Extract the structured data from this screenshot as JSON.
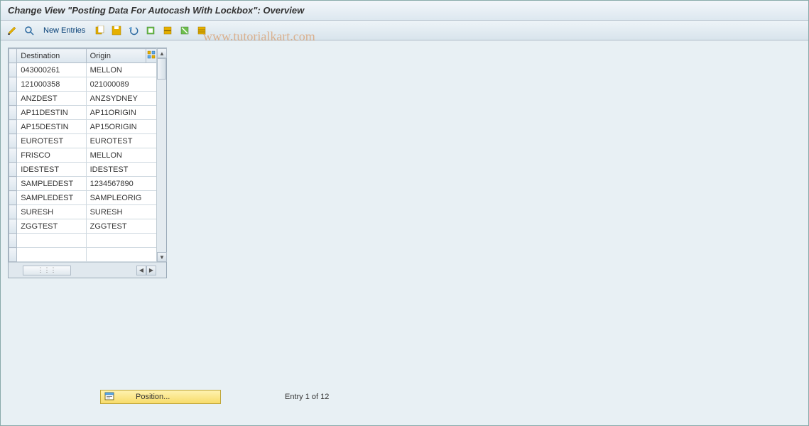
{
  "title": "Change View \"Posting Data For Autocash With Lockbox\": Overview",
  "toolbar": {
    "new_entries": "New Entries"
  },
  "watermark": "www.tutorialkart.com",
  "table": {
    "headers": {
      "destination": "Destination",
      "origin": "Origin"
    },
    "rows": [
      {
        "destination": "043000261",
        "origin": "MELLON"
      },
      {
        "destination": "121000358",
        "origin": "021000089"
      },
      {
        "destination": "ANZDEST",
        "origin": "ANZSYDNEY"
      },
      {
        "destination": "AP11DESTIN",
        "origin": "AP11ORIGIN"
      },
      {
        "destination": "AP15DESTIN",
        "origin": "AP15ORIGIN"
      },
      {
        "destination": "EUROTEST",
        "origin": "EUROTEST"
      },
      {
        "destination": "FRISCO",
        "origin": "MELLON"
      },
      {
        "destination": "IDESTEST",
        "origin": "IDESTEST"
      },
      {
        "destination": "SAMPLEDEST",
        "origin": "1234567890"
      },
      {
        "destination": "SAMPLEDEST",
        "origin": "SAMPLEORIG"
      },
      {
        "destination": "SURESH",
        "origin": "SURESH"
      },
      {
        "destination": "ZGGTEST",
        "origin": "ZGGTEST"
      },
      {
        "destination": "",
        "origin": ""
      },
      {
        "destination": "",
        "origin": ""
      }
    ]
  },
  "footer": {
    "position_label": "Position...",
    "entry_text": "Entry 1 of 12"
  }
}
